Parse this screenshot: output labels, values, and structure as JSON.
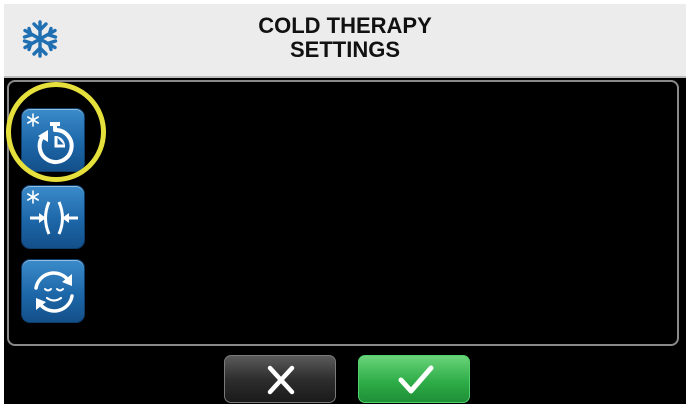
{
  "header": {
    "icon": "snowflake-icon",
    "title_line1": "COLD THERAPY",
    "title_line2": "SETTINGS"
  },
  "mode_buttons": [
    {
      "icon": "cold-timer-icon",
      "highlighted": true
    },
    {
      "icon": "cold-compression-icon",
      "highlighted": false
    },
    {
      "icon": "relax-cycle-icon",
      "highlighted": false
    }
  ],
  "footer": {
    "cancel_icon": "close-icon",
    "confirm_icon": "check-icon"
  },
  "colors": {
    "accent_blue": "#1d67a9",
    "confirm_green": "#2fae48",
    "highlight_yellow": "#e6e03c"
  }
}
